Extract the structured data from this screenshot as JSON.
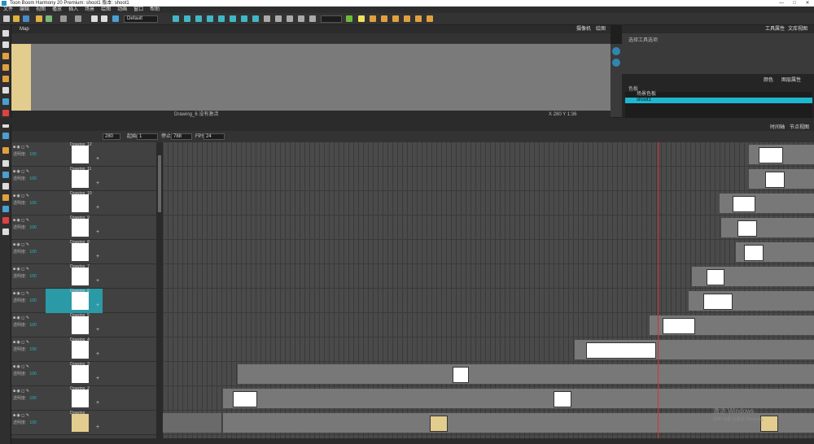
{
  "window": {
    "title": "Toon Boom Harmony 20 Premium: shoot1 版本: shoot1",
    "controls": [
      "—",
      "□",
      "✕"
    ]
  },
  "menu": [
    "文件",
    "编辑",
    "视图",
    "播放",
    "插入",
    "场景",
    "绘图",
    "动画",
    "窗口",
    "帮助"
  ],
  "toolbar": {
    "preset": "Default"
  },
  "view": {
    "tab": "Map",
    "right_tabs": [
      "摄像机",
      "绘图"
    ],
    "status": "Drawing_6 没有激活",
    "coords": "X 280   Y 1:36"
  },
  "right_panel": {
    "tabs": [
      "工具属性",
      "文库视图"
    ],
    "subtitle": "选择工具选项",
    "colors_tabs": [
      "颜色",
      "图层属性"
    ],
    "colors_title": "色板",
    "palette_header": "场景色板",
    "palette_item": "shoot1"
  },
  "timeline": {
    "tabs": [
      "时间轴",
      "节点视图"
    ],
    "frame": "280",
    "start_label": "起始",
    "start": "1",
    "end_label": "停止",
    "end": "788",
    "fps_label": "FPS",
    "fps": "24"
  },
  "layers": [
    {
      "name": "Drawing_12",
      "sub": "透明度:",
      "value": "100"
    },
    {
      "name": "Drawing_11",
      "sub": "透明度:",
      "value": "100"
    },
    {
      "name": "Drawing_10",
      "sub": "透明度:",
      "value": "100"
    },
    {
      "name": "Drawing_9",
      "sub": "透明度:",
      "value": "100"
    },
    {
      "name": "Drawing_8",
      "sub": "透明度:",
      "value": "100"
    },
    {
      "name": "Drawing_7",
      "sub": "透明度:",
      "value": "100"
    },
    {
      "name": "Drawing_6",
      "sub": "透明度:",
      "value": "100"
    },
    {
      "name": "Drawing_5",
      "sub": "透明度:",
      "value": "100"
    },
    {
      "name": "Drawing_4",
      "sub": "透明度:",
      "value": "100"
    },
    {
      "name": "Drawing_3",
      "sub": "透明度:",
      "value": "100"
    },
    {
      "name": "Drawing_2",
      "sub": "透明度:",
      "value": "100"
    },
    {
      "name": "Drawing",
      "sub": "透明度:",
      "value": "100"
    }
  ],
  "watermark": {
    "line1": "激活 Windows",
    "line2": "转到\"设置\"以激活 Windows。"
  },
  "colors": {
    "accent": "#2a9aa6",
    "canvas_swatch": "#e3cd8e",
    "playhead": "#d03535",
    "selected_palette": "#1fb7d0"
  }
}
